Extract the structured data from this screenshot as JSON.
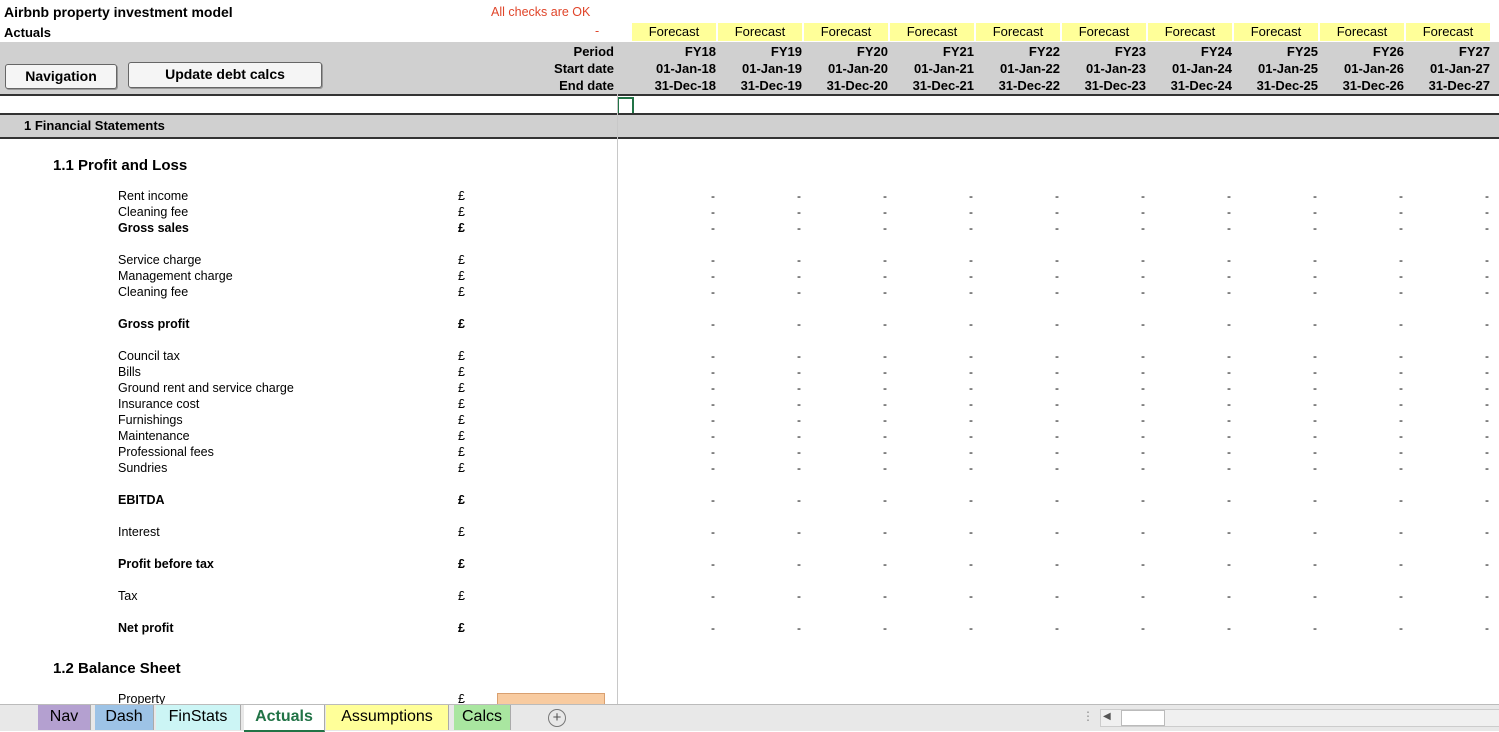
{
  "title": "Airbnb property investment model",
  "subtitle": "Actuals",
  "check_status": "All checks are OK",
  "check_value": "-",
  "buttons": {
    "navigation": "Navigation",
    "update_debt": "Update debt calcs"
  },
  "header": {
    "period_label": "Period",
    "start_label": "Start date",
    "end_label": "End date",
    "forecast_label": "Forecast",
    "periods": [
      "FY18",
      "FY19",
      "FY20",
      "FY21",
      "FY22",
      "FY23",
      "FY24",
      "FY25",
      "FY26",
      "FY27"
    ],
    "start_dates": [
      "01-Jan-18",
      "01-Jan-19",
      "01-Jan-20",
      "01-Jan-21",
      "01-Jan-22",
      "01-Jan-23",
      "01-Jan-24",
      "01-Jan-25",
      "01-Jan-26",
      "01-Jan-27"
    ],
    "end_dates": [
      "31-Dec-18",
      "31-Dec-19",
      "31-Dec-20",
      "31-Dec-21",
      "31-Dec-22",
      "31-Dec-23",
      "31-Dec-24",
      "31-Dec-25",
      "31-Dec-26",
      "31-Dec-27"
    ]
  },
  "section": "1 Financial Statements",
  "subsections": {
    "pl": "1.1  Profit and Loss",
    "bs": "1.2  Balance Sheet"
  },
  "rows": [
    {
      "label": "Rent income",
      "unit": "£",
      "bold": false,
      "value": "-"
    },
    {
      "label": "Cleaning fee",
      "unit": "£",
      "bold": false,
      "value": "-"
    },
    {
      "label": "Gross sales",
      "unit": "£",
      "bold": true,
      "value": "-"
    },
    {
      "label": "Service charge",
      "unit": "£",
      "bold": false,
      "value": "-"
    },
    {
      "label": "Management charge",
      "unit": "£",
      "bold": false,
      "value": "-"
    },
    {
      "label": "Cleaning fee",
      "unit": "£",
      "bold": false,
      "value": "-"
    },
    {
      "label": "Gross profit",
      "unit": "£",
      "bold": true,
      "value": "-"
    },
    {
      "label": "Council tax",
      "unit": "£",
      "bold": false,
      "value": "-"
    },
    {
      "label": "Bills",
      "unit": "£",
      "bold": false,
      "value": "-"
    },
    {
      "label": "Ground rent and service charge",
      "unit": "£",
      "bold": false,
      "value": "-"
    },
    {
      "label": "Insurance cost",
      "unit": "£",
      "bold": false,
      "value": "-"
    },
    {
      "label": "Furnishings",
      "unit": "£",
      "bold": false,
      "value": "-"
    },
    {
      "label": "Maintenance",
      "unit": "£",
      "bold": false,
      "value": "-"
    },
    {
      "label": "Professional fees",
      "unit": "£",
      "bold": false,
      "value": "-"
    },
    {
      "label": "Sundries",
      "unit": "£",
      "bold": false,
      "value": "-"
    },
    {
      "label": "EBITDA",
      "unit": "£",
      "bold": true,
      "value": "-"
    },
    {
      "label": "Interest",
      "unit": "£",
      "bold": false,
      "value": "-"
    },
    {
      "label": "Profit before tax",
      "unit": "£",
      "bold": true,
      "value": "-"
    },
    {
      "label": "Tax",
      "unit": "£",
      "bold": false,
      "value": "-"
    },
    {
      "label": "Net profit",
      "unit": "£",
      "bold": true,
      "value": "-"
    }
  ],
  "bs_rows": [
    {
      "label": "Property",
      "unit": "£"
    }
  ],
  "tabs": [
    {
      "label": "Nav",
      "color": "#b4a0d0"
    },
    {
      "label": "Dash",
      "color": "#9dc3e6"
    },
    {
      "label": "FinStats",
      "color": "#ccf5f5"
    },
    {
      "label": "Actuals",
      "color": "#ffffff",
      "active": true
    },
    {
      "label": "Assumptions",
      "color": "#ffff99"
    },
    {
      "label": "Calcs",
      "color": "#a9e6a0"
    }
  ],
  "add_sheet": "+"
}
